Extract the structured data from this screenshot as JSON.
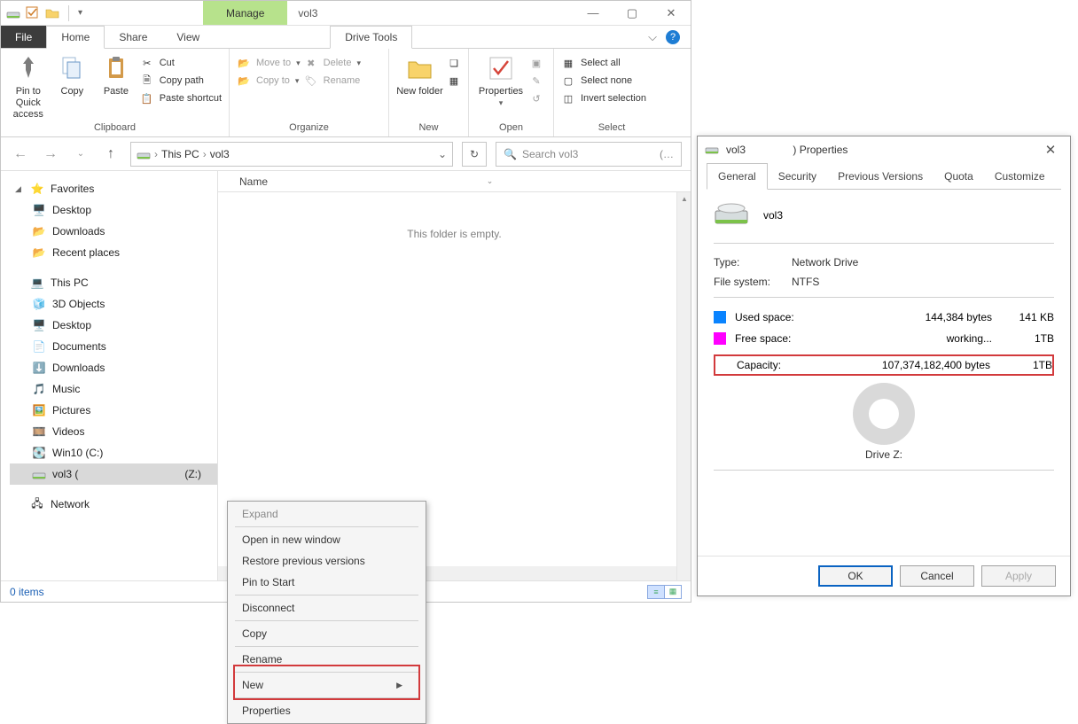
{
  "titlebar": {
    "manage_label": "Manage",
    "window_title": "vol3"
  },
  "tabs": {
    "file": "File",
    "home": "Home",
    "share": "Share",
    "view": "View",
    "drive_tools": "Drive Tools"
  },
  "ribbon": {
    "clipboard": {
      "label": "Clipboard",
      "pin_quick": "Pin to Quick access",
      "copy": "Copy",
      "paste": "Paste",
      "cut": "Cut",
      "copy_path": "Copy path",
      "paste_shortcut": "Paste shortcut"
    },
    "organize": {
      "label": "Organize",
      "move_to": "Move to",
      "copy_to": "Copy to",
      "delete": "Delete",
      "rename": "Rename"
    },
    "new": {
      "label": "New",
      "new_folder": "New folder"
    },
    "open": {
      "label": "Open",
      "properties": "Properties"
    },
    "select": {
      "label": "Select",
      "select_all": "Select all",
      "select_none": "Select none",
      "invert": "Invert selection"
    }
  },
  "address": {
    "root": "This PC",
    "path": "vol3",
    "search_placeholder": "Search vol3"
  },
  "tree": {
    "favorites": "Favorites",
    "desktop": "Desktop",
    "downloads": "Downloads",
    "recent": "Recent places",
    "this_pc": "This PC",
    "obj3d": "3D Objects",
    "desktop2": "Desktop",
    "documents": "Documents",
    "downloads2": "Downloads",
    "music": "Music",
    "pictures": "Pictures",
    "videos": "Videos",
    "win10": "Win10 (C:)",
    "vol3": "vol3 (",
    "vol3_letter": "(Z:)",
    "network": "Network"
  },
  "files": {
    "column_name": "Name",
    "empty_msg": "This folder is empty."
  },
  "status": {
    "items": "0 items"
  },
  "context_menu": {
    "expand": "Expand",
    "open_new": "Open in new window",
    "restore": "Restore previous versions",
    "pin_start": "Pin to Start",
    "disconnect": "Disconnect",
    "copy": "Copy",
    "rename": "Rename",
    "new": "New",
    "properties": "Properties"
  },
  "properties": {
    "title_prefix": "vol3",
    "title_suffix": ") Properties",
    "tabs": {
      "general": "General",
      "security": "Security",
      "prev": "Previous Versions",
      "quota": "Quota",
      "customize": "Customize"
    },
    "volume_name": "vol3",
    "type_label": "Type:",
    "type_value": "Network Drive",
    "fs_label": "File system:",
    "fs_value": "NTFS",
    "used_label": "Used space:",
    "used_bytes": "144,384 bytes",
    "used_human": "141 KB",
    "free_label": "Free space:",
    "free_bytes": "working...",
    "free_human": "1TB",
    "cap_label": "Capacity:",
    "cap_bytes": "107,374,182,400 bytes",
    "cap_human": "1TB",
    "drive_label": "Drive Z:",
    "btn_ok": "OK",
    "btn_cancel": "Cancel",
    "btn_apply": "Apply"
  },
  "colors": {
    "used": "#0a84ff",
    "free": "#ff00ff"
  }
}
